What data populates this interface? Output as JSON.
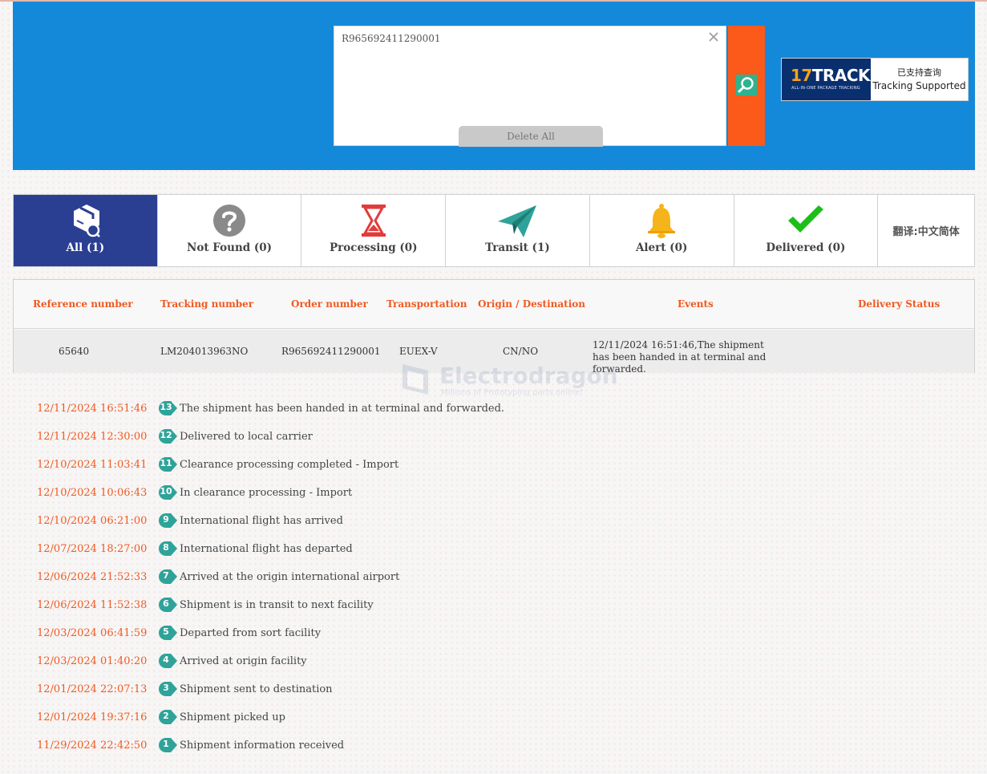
{
  "search": {
    "value": "R965692411290001",
    "delete_all": "Delete All"
  },
  "badge": {
    "brand_num": "17",
    "brand_word": "TRACK",
    "brand_sub": "ALL-IN-ONE PACKAGE TRACKING",
    "cn": "已支持查询",
    "en": "Tracking Supported"
  },
  "tabs": [
    {
      "label": "All (1)",
      "icon": "package-icon"
    },
    {
      "label": "Not Found (0)",
      "icon": "question-icon"
    },
    {
      "label": "Processing (0)",
      "icon": "hourglass-icon"
    },
    {
      "label": "Transit (1)",
      "icon": "paper-plane-icon"
    },
    {
      "label": "Alert (0)",
      "icon": "bell-icon"
    },
    {
      "label": "Delivered (0)",
      "icon": "checkmark-icon"
    },
    {
      "label": "翻译:中文简体"
    }
  ],
  "table": {
    "headers": [
      "Reference number",
      "Tracking number",
      "Order number",
      "Transportation",
      "Origin / Destination",
      "Events",
      "Delivery Status"
    ],
    "row": {
      "reference": "65640",
      "tracking": "LM204013963NO",
      "order": "R965692411290001",
      "transport": "EUEX-V",
      "route": "CN/NO",
      "events": "12/11/2024 16:51:46,The shipment has been handed in at terminal and forwarded.",
      "status": ""
    }
  },
  "watermark": {
    "title": "Electrodragon",
    "sub": "Millions of Prototyping parts online!"
  },
  "events": [
    {
      "time": "12/11/2024 16:51:46",
      "num": "13",
      "text": "The shipment has been handed in at terminal and forwarded."
    },
    {
      "time": "12/11/2024 12:30:00",
      "num": "12",
      "text": "Delivered to local carrier"
    },
    {
      "time": "12/10/2024 11:03:41",
      "num": "11",
      "text": "Clearance processing completed - Import"
    },
    {
      "time": "12/10/2024 10:06:43",
      "num": "10",
      "text": "In clearance processing - Import"
    },
    {
      "time": "12/10/2024 06:21:00",
      "num": "9",
      "text": "International flight has arrived"
    },
    {
      "time": "12/07/2024 18:27:00",
      "num": "8",
      "text": "International flight has departed"
    },
    {
      "time": "12/06/2024 21:52:33",
      "num": "7",
      "text": "Arrived at the origin international airport"
    },
    {
      "time": "12/06/2024 11:52:38",
      "num": "6",
      "text": "Shipment is in transit to next facility"
    },
    {
      "time": "12/03/2024 06:41:59",
      "num": "5",
      "text": "Departed from sort facility"
    },
    {
      "time": "12/03/2024 01:40:20",
      "num": "4",
      "text": "Arrived at origin facility"
    },
    {
      "time": "12/01/2024 22:07:13",
      "num": "3",
      "text": "Shipment sent to destination"
    },
    {
      "time": "12/01/2024 19:37:16",
      "num": "2",
      "text": "Shipment picked up"
    },
    {
      "time": "11/29/2024 22:42:50",
      "num": "1",
      "text": "Shipment information received"
    }
  ],
  "colors": {
    "header_blue": "#1489da",
    "search_orange": "#fb5a1b",
    "active_tab": "#2b3f92",
    "accent_orange": "#ef5a22",
    "badge_teal": "#2fa39a"
  }
}
